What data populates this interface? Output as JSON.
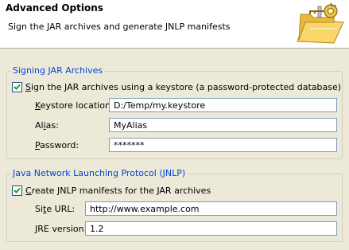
{
  "header": {
    "title": "Advanced Options",
    "description": "Sign the JAR archives and generate JNLP manifests",
    "image_icon": "folder-with-key-icon"
  },
  "signing": {
    "title": "Signing JAR Archives",
    "checkbox": {
      "label_mnemonic": "S",
      "label_rest": "ign the JAR archives using a keystore (a password-protected database)",
      "checked": true
    },
    "fields": {
      "keystore": {
        "label_mnemonic": "K",
        "label_rest": "eystore location:",
        "value": "D:/Temp/my.keystore"
      },
      "alias": {
        "label_pre": "Al",
        "label_mnemonic": "i",
        "label_rest": "as:",
        "value": "MyAlias"
      },
      "password": {
        "label_mnemonic": "P",
        "label_rest": "assword:",
        "value": "*******"
      }
    }
  },
  "jnlp": {
    "title": "Java Network Launching Protocol (JNLP)",
    "checkbox": {
      "label_mnemonic": "C",
      "label_rest": "reate JNLP manifests for the JAR archives",
      "checked": true
    },
    "fields": {
      "site_url": {
        "label_pre": "Si",
        "label_mnemonic": "t",
        "label_rest": "e URL:",
        "value": "http://www.example.com"
      },
      "jre_version": {
        "label_mnemonic": "J",
        "label_rest": "RE version:",
        "value": "1.2"
      }
    }
  },
  "colors": {
    "group_title": "#0046d5",
    "check_mark": "#21a121",
    "background": "#ece9d8"
  }
}
